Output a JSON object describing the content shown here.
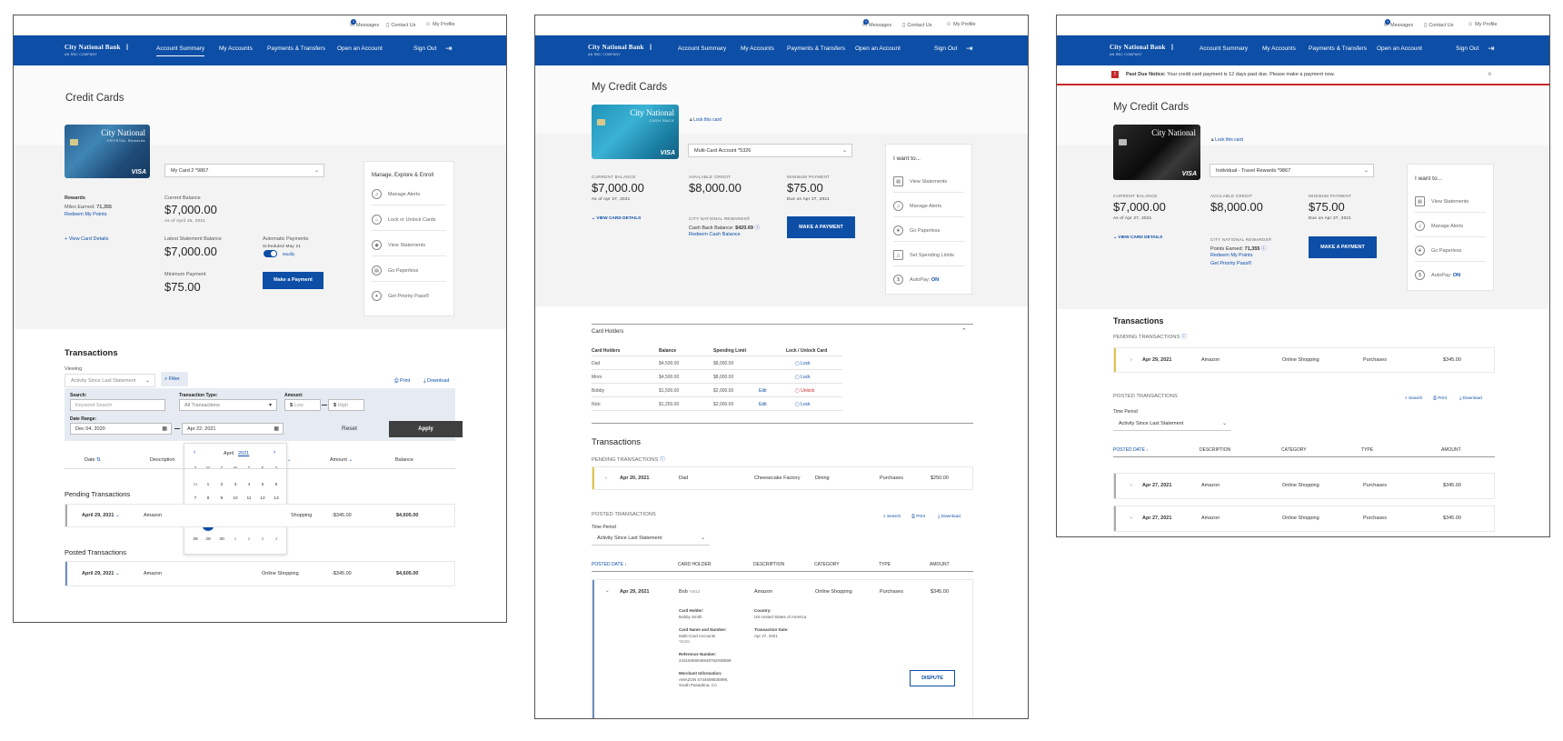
{
  "common": {
    "utility": {
      "messages": "Messages",
      "contact": "Contact Us",
      "profile": "My Profile",
      "badge": "1"
    },
    "brand": {
      "name": "City National Bank",
      "sub": "AN RBC COMPANY"
    },
    "nav": {
      "summary": "Account Summary",
      "accounts": "My Accounts",
      "payments": "Payments & Transfers",
      "open": "Open an Account",
      "signout": "Sign Out"
    },
    "card_visa": "VISA",
    "card_brand": "City National"
  },
  "screen1": {
    "title": "Credit Cards",
    "card_sub": "CRYSTAL Rewards",
    "card_select": "My Card 2 *9867",
    "rewards_label": "Rewards",
    "miles_label": "Miles Earned:",
    "miles_value": "71,355",
    "redeem": "Redeem My Points",
    "view_details": "+ View Card Details",
    "current_label": "Current Balance",
    "current_value": "$7,000.00",
    "current_asof": "As of April 25, 2021",
    "statement_label": "Latest Statement Balance",
    "statement_value": "$7,000.00",
    "auto_label": "Automatic Payments",
    "auto_sched": "Scheduled May 21",
    "modify": "Modify",
    "min_label": "Minimum Payment",
    "min_value": "$75.00",
    "pay_btn": "Make a Payment",
    "panel": {
      "title": "Manage, Explore & Enroll",
      "items": [
        "Manage Alerts",
        "Lock or Unlock Cards",
        "View Statements",
        "Go Paperless",
        "Get Priority Pass®"
      ]
    },
    "transactions_title": "Transactions",
    "viewing_label": "Viewing",
    "viewing_value": "Activity Since Last Statement",
    "filter": "Filter",
    "print": "Print",
    "download": "Download",
    "search_label": "Search:",
    "search_placeholder": "Keyword Search",
    "type_label": "Transaction Type:",
    "type_value": "All Transactions",
    "amount_label": "Amount:",
    "low": "Low",
    "high": "High",
    "range_label": "Date Range:",
    "from": "Dec 04, 2020",
    "to": "Apr 22, 2021",
    "reset": "Reset",
    "apply": "Apply",
    "calendar": {
      "month": "April",
      "year": "2021",
      "dow": [
        "S",
        "M",
        "T",
        "W",
        "T",
        "F",
        "S"
      ],
      "weeks": [
        [
          "31",
          "1",
          "2",
          "3",
          "4",
          "5",
          "6"
        ],
        [
          "7",
          "8",
          "9",
          "10",
          "11",
          "12",
          "13"
        ],
        [
          "14",
          "15",
          "16",
          "17",
          "18",
          "19",
          "20"
        ],
        [
          "21",
          "22",
          "23",
          "24",
          "25",
          "26",
          "27"
        ],
        [
          "28",
          "29",
          "30",
          "1",
          "2",
          "3",
          "4"
        ]
      ],
      "selected": "22"
    },
    "headers": {
      "date": "Date",
      "description": "Description",
      "amount": "Amount",
      "balance": "Balance"
    },
    "pending_title": "Pending Transactions",
    "posted_title": "Posted Transactions",
    "pending_row": {
      "date": "April 29, 2021",
      "desc": "Amazon",
      "cat": "Shopping",
      "amount": "-$345.00",
      "balance": "$4,605.00"
    },
    "posted_row": {
      "date": "April 29, 2021",
      "desc": "Amazon",
      "cat": "Online Shopping",
      "amount": "-$345.00",
      "balance": "$4,605.00"
    }
  },
  "screen2": {
    "title": "My Credit Cards",
    "card_sub": "CASH BACK",
    "lock": "Lock this card",
    "card_select": "Multi-Card Account *5326",
    "current_label": "CURRENT BALANCE",
    "current_value": "$7,000.00",
    "current_asof": "As of Apr 27, 2021",
    "available_label": "AVAILABLE CREDIT",
    "available_value": "$8,000.00",
    "min_label": "MINIMUM PAYMENT",
    "min_value": "$75.00",
    "min_due": "Due on Apr 27, 2021",
    "view_details": "VIEW CARD DETAILS",
    "rewards_label": "CITY NATIONAL REWARDS®",
    "cashback_label": "Cash Back Balance:",
    "cashback_value": "$420.69",
    "redeem": "Redeem Cash Balance",
    "pay_btn": "MAKE A PAYMENT",
    "panel": {
      "title": "I want to...",
      "items": [
        "View Statements",
        "Manage Alerts",
        "Go Paperless",
        "Set Spending Limits",
        "AutoPay:"
      ],
      "autopay": "ON"
    },
    "holders_title": "Card Holders",
    "holders_headers": [
      "Card Holders",
      "Balance",
      "Spending Limit",
      "Lock / Unlock Card"
    ],
    "holders": [
      {
        "name": "Dad",
        "balance": "$4,500.00",
        "limit": "$8,000.00",
        "edit": "",
        "lock": "Lock"
      },
      {
        "name": "Mom",
        "balance": "$4,500.00",
        "limit": "$8,000.00",
        "edit": "",
        "lock": "Lock"
      },
      {
        "name": "Bobby",
        "balance": "$1,500.00",
        "limit": "$2,000.00",
        "edit": "Edit",
        "lock": "Unlock"
      },
      {
        "name": "Nick",
        "balance": "$1,250.00",
        "limit": "$2,000.00",
        "edit": "Edit",
        "lock": "Lock"
      }
    ],
    "transactions_title": "Transactions",
    "pending_title": "PENDING TRANSACTIONS",
    "pending_row": {
      "date": "Apr 20, 2021",
      "holder": "Dad",
      "desc": "Cheesecake Factory",
      "cat": "Dining",
      "type": "Purchases",
      "amount": "$250.00"
    },
    "posted_title": "POSTED TRANSACTIONS",
    "search": "Search",
    "print": "Print",
    "download": "Download",
    "period_label": "Time Period",
    "period_value": "Activity Since Last Statement",
    "headers": [
      "POSTED DATE",
      "CARD HOLDER",
      "DESCRIPTION",
      "CATEGORY",
      "TYPE",
      "AMOUNT"
    ],
    "posted_row": {
      "date": "Apr 29, 2021",
      "holder": "Bob",
      "holder_id": "*4812",
      "desc": "Amazon",
      "cat": "Online Shopping",
      "type": "Purchases",
      "amount": "$345.00"
    },
    "details": {
      "holder_label": "Card Holder:",
      "holder_value": "Bobby Smith",
      "country_label": "Country:",
      "country_value": "US-United States of America",
      "card_label": "Card Name and Number:",
      "card_value": "Multi-Card Accounts",
      "card_num": "*5326",
      "tdate_label": "Transaction Date:",
      "tdate_value": "Apr 27, 2021",
      "ref_label": "Reference Number:",
      "ref_value": "24316059046548762035599",
      "merchant_label": "Merchant Information:",
      "merchant_1": "AMAZON 5744698835999,",
      "merchant_2": "South Pasadena, CA"
    },
    "dispute": "DISPUTE"
  },
  "screen3": {
    "alert_strong": "Past Due Notice:",
    "alert_text": "Your credit card payment is 12 days past due. Please make a payment now.",
    "title": "My Credit Cards",
    "lock": "Lock this card",
    "card_select": "Individual - Travel Rewards *9867",
    "current_label": "CURRENT BALANCE",
    "current_value": "$7,000.00",
    "current_asof": "As of Apr 27, 2021",
    "available_label": "AVAILABLE CREDIT",
    "available_value": "$8,000.00",
    "min_label": "MINIMUM PAYMENT",
    "min_value": "$75.00",
    "min_due": "Due on Apr 27, 2021",
    "view_details": "VIEW CARD DETAILS",
    "rewards_label": "CITY NATIONAL REWARDS®",
    "points_label": "Points Earned:",
    "points_value": "71,355",
    "redeem": "Redeem My Points",
    "priority": "Get Priority Pass®",
    "pay_btn": "MAKE A PAYMENT",
    "panel": {
      "title": "I want to...",
      "items": [
        "View Statements",
        "Manage Alerts",
        "Go Paperless",
        "AutoPay:"
      ],
      "autopay": "ON"
    },
    "transactions_title": "Transactions",
    "pending_title": "PENDING TRANSACTIONS",
    "pending_row": {
      "date": "Apr 29, 2021",
      "desc": "Amazon",
      "cat": "Online Shopping",
      "type": "Purchases",
      "amount": "$345.00"
    },
    "posted_title": "POSTED TRANSACTIONS",
    "search": "Search",
    "print": "Print",
    "download": "Download",
    "period_label": "Time Period",
    "period_value": "Activity Since Last Statement",
    "headers": [
      "POSTED DATE",
      "DESCRIPTION",
      "CATEGORY",
      "TYPE",
      "AMOUNT"
    ],
    "rows": [
      {
        "date": "Apr 27, 2021",
        "desc": "Amazon",
        "cat": "Online Shopping",
        "type": "Purchases",
        "amount": "$345.00"
      },
      {
        "date": "Apr 27, 2021",
        "desc": "Amazon",
        "cat": "Online Shopping",
        "type": "Purchases",
        "amount": "$345.00"
      }
    ]
  }
}
